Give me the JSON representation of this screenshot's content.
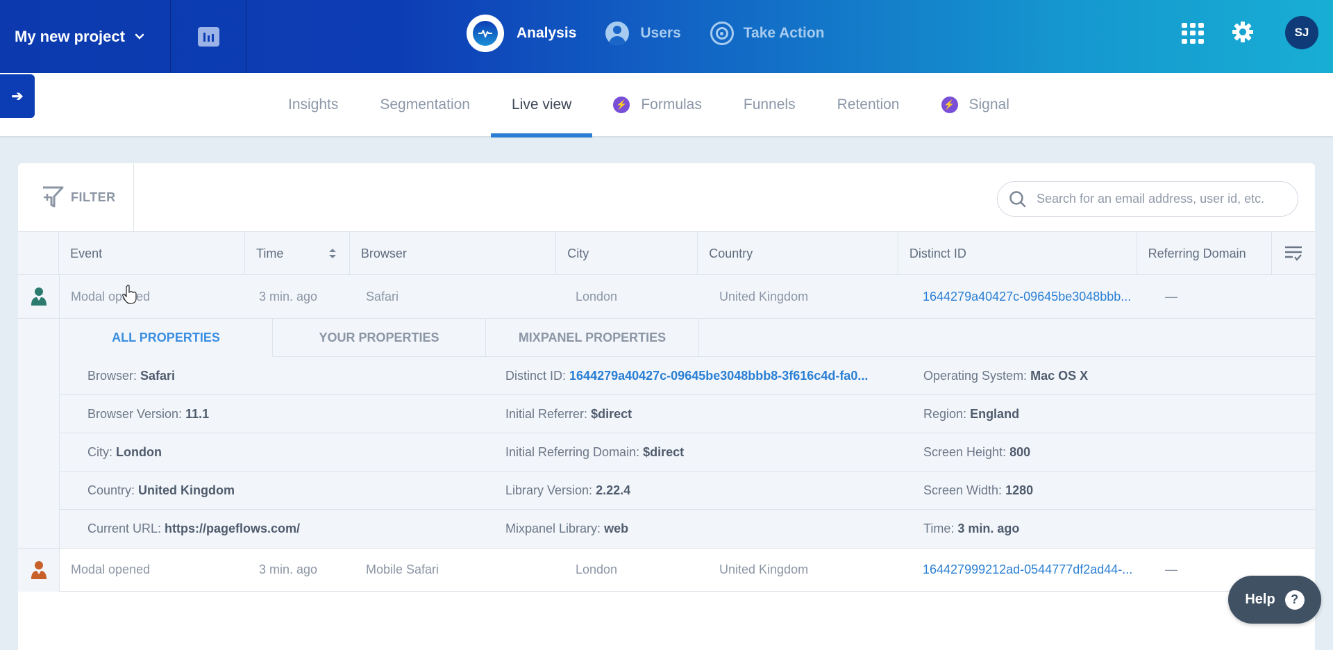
{
  "header": {
    "project_name": "My new project",
    "main_nav": [
      {
        "label": "Analysis",
        "icon": "analysis-pulse-icon",
        "active": true
      },
      {
        "label": "Users",
        "icon": "user-icon",
        "active": false
      },
      {
        "label": "Take Action",
        "icon": "target-icon",
        "active": false
      }
    ],
    "avatar_initials": "SJ"
  },
  "subnav": {
    "tabs": [
      {
        "label": "Insights",
        "active": false,
        "badge": false
      },
      {
        "label": "Segmentation",
        "active": false,
        "badge": false
      },
      {
        "label": "Live view",
        "active": true,
        "badge": false
      },
      {
        "label": "Formulas",
        "active": false,
        "badge": true
      },
      {
        "label": "Funnels",
        "active": false,
        "badge": false
      },
      {
        "label": "Retention",
        "active": false,
        "badge": false
      },
      {
        "label": "Signal",
        "active": false,
        "badge": true
      }
    ]
  },
  "toolbar": {
    "filter_label": "FILTER",
    "search_placeholder": "Search for an email address, user id, etc."
  },
  "table": {
    "columns": [
      "Event",
      "Time",
      "Browser",
      "City",
      "Country",
      "Distinct ID",
      "Referring Domain"
    ],
    "rows": [
      {
        "user_color": "#2b7b6e",
        "event": "Modal opened",
        "time": "3 min. ago",
        "browser": "Safari",
        "city": "London",
        "country": "United Kingdom",
        "distinct_id": "1644279a40427c-09645be3048bbb...",
        "referring_domain": "—",
        "expanded": true
      },
      {
        "user_color": "#c8602a",
        "event": "Modal opened",
        "time": "3 min. ago",
        "browser": "Mobile Safari",
        "city": "London",
        "country": "United Kingdom",
        "distinct_id": "164427999212ad-0544777df2ad44-...",
        "referring_domain": "—",
        "expanded": false
      }
    ]
  },
  "details": {
    "tabs": [
      {
        "label": "ALL PROPERTIES",
        "active": true
      },
      {
        "label": "YOUR PROPERTIES",
        "active": false
      },
      {
        "label": "MIXPANEL PROPERTIES",
        "active": false
      }
    ],
    "properties": [
      [
        {
          "key": "Browser:",
          "value": "Safari"
        },
        {
          "key": "Distinct ID:",
          "value": "1644279a40427c-09645be3048bbb8-3f616c4d-fa0...",
          "link": true
        },
        {
          "key": "Operating System:",
          "value": "Mac OS X"
        }
      ],
      [
        {
          "key": "Browser Version:",
          "value": "11.1"
        },
        {
          "key": "Initial Referrer:",
          "value": "$direct"
        },
        {
          "key": "Region:",
          "value": "England"
        }
      ],
      [
        {
          "key": "City:",
          "value": "London"
        },
        {
          "key": "Initial Referring Domain:",
          "value": "$direct"
        },
        {
          "key": "Screen Height:",
          "value": "800"
        }
      ],
      [
        {
          "key": "Country:",
          "value": "United Kingdom"
        },
        {
          "key": "Library Version:",
          "value": "2.22.4"
        },
        {
          "key": "Screen Width:",
          "value": "1280"
        }
      ],
      [
        {
          "key": "Current URL:",
          "value": "https://pageflows.com/"
        },
        {
          "key": "Mixpanel Library:",
          "value": "web"
        },
        {
          "key": "Time:",
          "value": "3 min. ago"
        }
      ]
    ]
  },
  "help": {
    "label": "Help",
    "icon_glyph": "?"
  },
  "colors": {
    "accent": "#2a7fd4",
    "brand": "#0d3db5",
    "feature_badge": "#7a4fd8"
  }
}
